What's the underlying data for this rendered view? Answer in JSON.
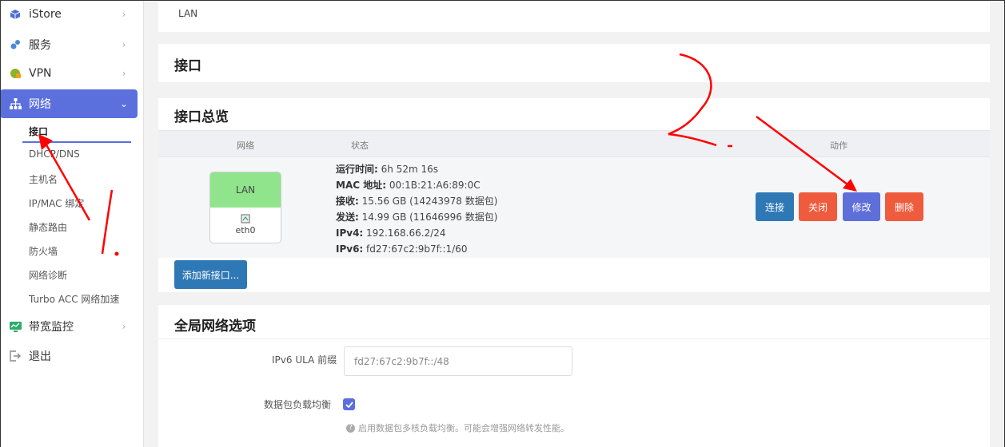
{
  "sidebar": {
    "items": [
      {
        "label": "iStore",
        "icon": "cube-icon"
      },
      {
        "label": "服务",
        "icon": "puzzle-icon"
      },
      {
        "label": "VPN",
        "icon": "globe-lock-icon"
      },
      {
        "label": "网络",
        "icon": "sitemap-icon"
      },
      {
        "label": "带宽监控",
        "icon": "monitor-chart-icon"
      },
      {
        "label": "退出",
        "icon": "logout-icon"
      }
    ],
    "network_submenu": [
      "接口",
      "DHCP/DNS",
      "主机名",
      "IP/MAC 绑定",
      "静态路由",
      "防火墙",
      "网络诊断",
      "Turbo ACC 网络加速"
    ]
  },
  "top_panel": {
    "text": "LAN"
  },
  "page_title": "接口",
  "overview": {
    "title": "接口总览",
    "columns": {
      "network": "网络",
      "status": "状态",
      "actions": "动作"
    },
    "row": {
      "iface_name": "LAN",
      "device": "eth0",
      "uptime_label": "运行时间:",
      "uptime_value": " 6h 52m 16s",
      "mac_label": "MAC 地址:",
      "mac_value": " 00:1B:21:A6:89:0C",
      "rx_label": "接收:",
      "rx_value": " 15.56 GB (14243978 数据包)",
      "tx_label": "发送:",
      "tx_value": " 14.99 GB (11646996 数据包)",
      "ipv4_label": "IPv4:",
      "ipv4_value": " 192.168.66.2/24",
      "ipv6_label": "IPv6:",
      "ipv6_value": " fd27:67c2:9b7f::1/60"
    },
    "buttons": {
      "connect": "连接",
      "close": "关闭",
      "edit": "修改",
      "delete": "删除",
      "add": "添加新接口..."
    }
  },
  "global": {
    "title": "全局网络选项",
    "ula_label": "IPv6 ULA 前缀",
    "ula_value": "fd27:67c2:9b7f::/48",
    "pktsteer_label": "数据包负载均衡",
    "pktsteer_checked": true,
    "pktsteer_hint": "启用数据包多核负载均衡。可能会增强网络转发性能。"
  },
  "colors": {
    "accent": "#5b6fdd",
    "lan_green": "#90e58c",
    "blue_btn": "#2f78b6",
    "red_btn": "#ee5b3d",
    "annotation_red": "#ff0000"
  },
  "annotations": {
    "mark1": "1.",
    "mark2": "2."
  }
}
